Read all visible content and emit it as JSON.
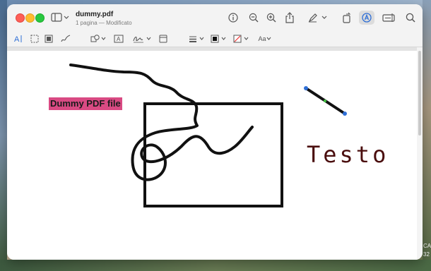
{
  "window": {
    "doc_title": "dummy.pdf",
    "doc_subtitle": "1 pagina — Modificato"
  },
  "titlebar_icons": [
    "sidebar-icon",
    "info-icon",
    "zoom-out-icon",
    "zoom-in-icon",
    "share-icon",
    "highlight-pen-icon",
    "rotate-icon",
    "markup-icon",
    "form-icon",
    "search-icon"
  ],
  "markup_toolbar": {
    "text_style_label": "Aa"
  },
  "document": {
    "pdf_text": "Dummy PDF file",
    "text_annotation": "Testo"
  },
  "desktop": {
    "corner_text_1": "CA",
    "corner_text_2": "32"
  },
  "colors": {
    "highlight": "#d94a83",
    "text_annotation": "#4a0e0e",
    "active_tool_bg": "#dcdcdc",
    "line_handle": "#2f6fd6"
  }
}
